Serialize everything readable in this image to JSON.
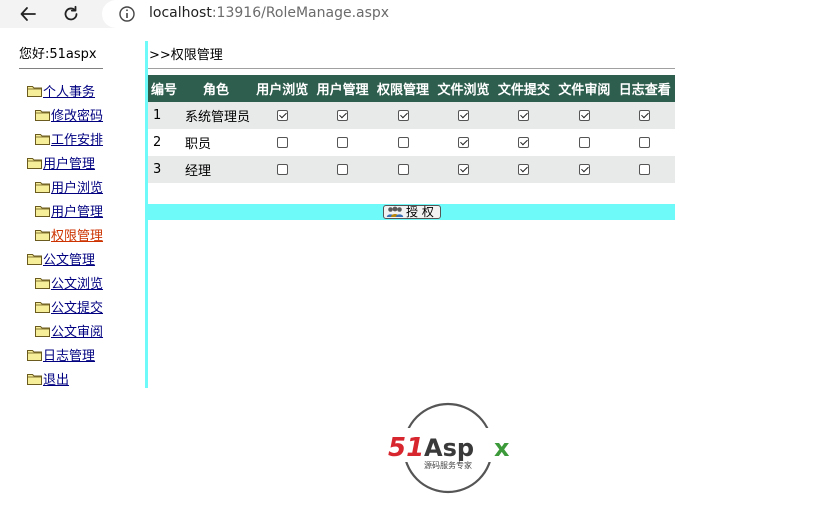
{
  "browser": {
    "url_host": "localhost",
    "url_rest": ":13916/RoleManage.aspx"
  },
  "greeting": "您好:51aspx",
  "tree": [
    {
      "label": "个人事务",
      "level": 0,
      "active": false
    },
    {
      "label": "修改密码",
      "level": 1,
      "active": false
    },
    {
      "label": "工作安排",
      "level": 1,
      "active": false
    },
    {
      "label": "用户管理",
      "level": 0,
      "active": false
    },
    {
      "label": "用户浏览",
      "level": 1,
      "active": false
    },
    {
      "label": "用户管理",
      "level": 1,
      "active": false
    },
    {
      "label": "权限管理",
      "level": 1,
      "active": true
    },
    {
      "label": "公文管理",
      "level": 0,
      "active": false
    },
    {
      "label": "公文浏览",
      "level": 1,
      "active": false
    },
    {
      "label": "公文提交",
      "level": 1,
      "active": false
    },
    {
      "label": "公文审阅",
      "level": 1,
      "active": false
    },
    {
      "label": "日志管理",
      "level": 0,
      "active": false
    },
    {
      "label": "退出",
      "level": 0,
      "active": false
    }
  ],
  "breadcrumb": ">>权限管理",
  "grid": {
    "headers": [
      "编号",
      "角色",
      "用户浏览",
      "用户管理",
      "权限管理",
      "文件浏览",
      "文件提交",
      "文件审阅",
      "日志查看"
    ],
    "rows": [
      {
        "id": "1",
        "role": "系统管理员",
        "perms": [
          true,
          true,
          true,
          true,
          true,
          true,
          true
        ]
      },
      {
        "id": "2",
        "role": "职员",
        "perms": [
          false,
          false,
          false,
          true,
          true,
          false,
          false
        ]
      },
      {
        "id": "3",
        "role": "经理",
        "perms": [
          false,
          false,
          false,
          true,
          true,
          true,
          false
        ]
      }
    ]
  },
  "authorize_button": "授 权",
  "logo": {
    "brand_red": "51",
    "brand_dark": "Asp",
    "brand_green": "x",
    "tagline": "源码服务专家",
    "colors": {
      "red": "#d7262e",
      "dark": "#3a3a3a",
      "green": "#3d9a3a"
    }
  },
  "colors": {
    "header_bg": "#2e5e4e",
    "accent_cyan": "#6ffafa",
    "link": "#000080",
    "link_active": "#cc3300"
  }
}
